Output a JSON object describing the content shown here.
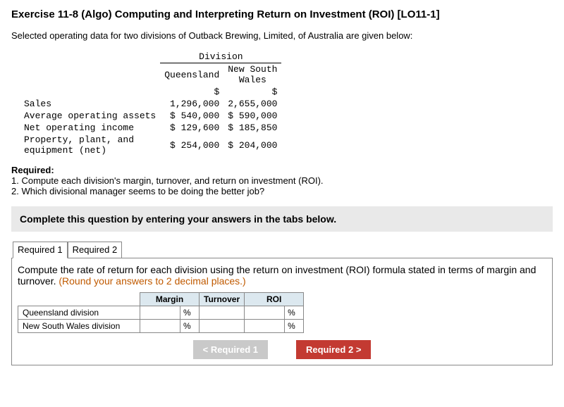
{
  "title": "Exercise 11-8 (Algo) Computing and Interpreting Return on Investment (ROI) [LO11-1]",
  "subtitle": "Selected operating data for two divisions of Outback Brewing, Limited, of Australia are given below:",
  "dataTable": {
    "groupHeader": "Division",
    "col1": "Queensland",
    "col2": "New South\nWales",
    "currency1": "$",
    "currency2": "$",
    "rows": {
      "sales": {
        "label": "Sales",
        "v1": "1,296,000",
        "v2": "2,655,000"
      },
      "assets": {
        "label": "Average operating assets",
        "v1": "$ 540,000",
        "v2": "$ 590,000"
      },
      "noi": {
        "label": "Net operating income",
        "v1": "$ 129,600",
        "v2": "$ 185,850"
      },
      "ppe": {
        "label": "Property, plant, and\nequipment (net)",
        "v1": "$ 254,000",
        "v2": "$ 204,000"
      }
    }
  },
  "required": {
    "label": "Required:",
    "line1": "1. Compute each division's margin, turnover, and return on investment (ROI).",
    "line2": "2. Which divisional manager seems to be doing the better job?"
  },
  "instructionBar": "Complete this question by entering your answers in the tabs below.",
  "tabs": {
    "t1": "Required\n1",
    "t2": "Required\n2"
  },
  "panel": {
    "instrMain": "Compute the rate of return for each division using the return on investment (ROI) formula stated in terms of margin and turnover. ",
    "instrOrange": "(Round your answers to 2 decimal places.)",
    "cols": {
      "margin": "Margin",
      "turnover": "Turnover",
      "roi": "ROI"
    },
    "rows": {
      "qld": "Queensland division",
      "nsw": "New South Wales division"
    },
    "unit": "%"
  },
  "nav": {
    "prev": "Required 1",
    "next": "Required 2"
  }
}
